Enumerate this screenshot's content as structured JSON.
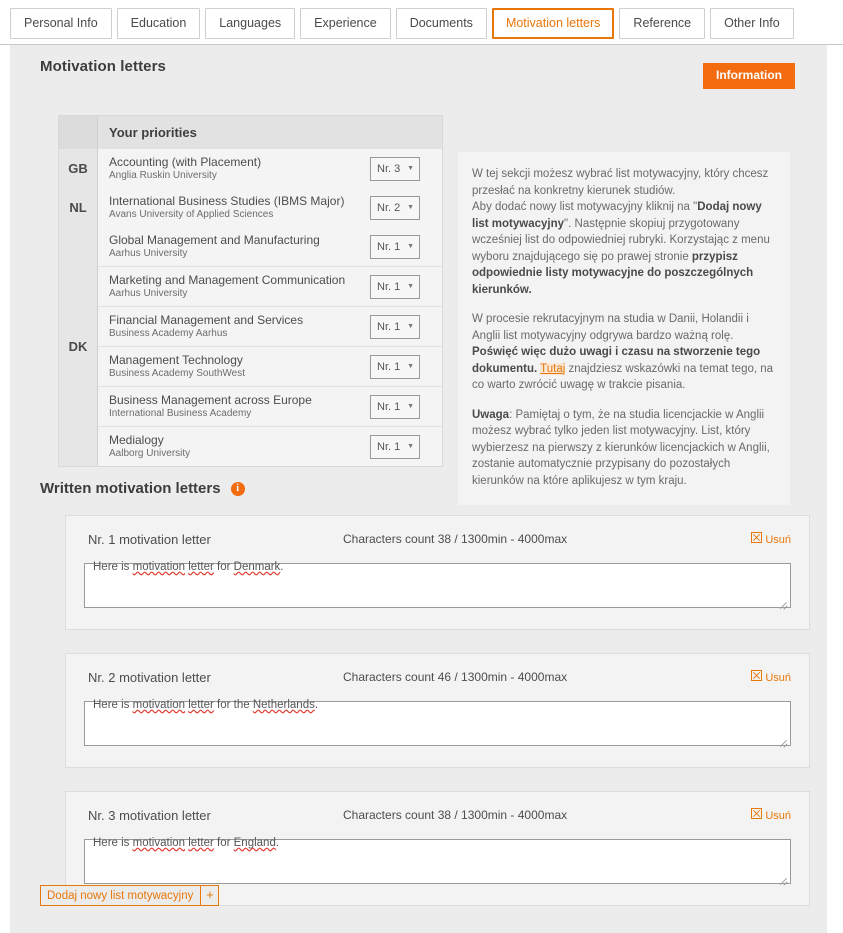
{
  "tabs": [
    {
      "label": "Personal Info",
      "active": false
    },
    {
      "label": "Education",
      "active": false
    },
    {
      "label": "Languages",
      "active": false
    },
    {
      "label": "Experience",
      "active": false
    },
    {
      "label": "Documents",
      "active": false
    },
    {
      "label": "Motivation letters",
      "active": true
    },
    {
      "label": "Reference",
      "active": false
    },
    {
      "label": "Other Info",
      "active": false
    }
  ],
  "page": {
    "title": "Motivation letters",
    "information_button": "Information"
  },
  "priorities_table": {
    "header": {
      "country": "",
      "title": "Your priorities",
      "select": ""
    },
    "groups": [
      {
        "country": "GB",
        "rows": [
          {
            "program": "Accounting (with Placement)",
            "institution": "Anglia Ruskin University",
            "selected": "Nr. 3"
          }
        ]
      },
      {
        "country": "NL",
        "rows": [
          {
            "program": "International Business Studies (IBMS Major)",
            "institution": "Avans University of Applied Sciences",
            "selected": "Nr. 2"
          }
        ]
      },
      {
        "country": "DK",
        "rows": [
          {
            "program": "Global Management and Manufacturing",
            "institution": "Aarhus University",
            "selected": "Nr. 1"
          },
          {
            "program": "Marketing and Management Communication",
            "institution": "Aarhus University",
            "selected": "Nr. 1"
          },
          {
            "program": "Financial Management and Services",
            "institution": "Business Academy Aarhus",
            "selected": "Nr. 1"
          },
          {
            "program": "Management Technology",
            "institution": "Business Academy SouthWest",
            "selected": "Nr. 1"
          },
          {
            "program": "Business Management across Europe",
            "institution": "International Business Academy",
            "selected": "Nr. 1"
          },
          {
            "program": "Medialogy",
            "institution": "Aalborg University",
            "selected": "Nr. 1"
          }
        ]
      }
    ]
  },
  "info_panel": {
    "p1_a": "W tej sekcji możesz wybrać list motywacyjny, który chcesz przesłać na konkretny kierunek studiów.",
    "p1_b": "Aby dodać nowy list motywacyjny kliknij na \"",
    "p1_bold1": "Dodaj nowy list motywacyjny",
    "p1_c": "\". Następnie skopiuj przygotowany wcześniej list do odpowiedniej rubryki. Korzystając z menu wyboru znajdującego się po prawej stronie ",
    "p1_bold2": "przypisz odpowiednie listy motywacyjne do poszczególnych kierunków.",
    "p2_a": "W procesie rekrutacyjnym na studia w Danii, Holandii i Anglii list motywacyjny odgrywa bardzo ważną rolę. ",
    "p2_bold": "Poświęć więc dużo uwagi i czasu na stworzenie tego dokumentu.",
    "p2_link": "Tutaj",
    "p2_b": " znajdziesz wskazówki na temat tego, na co warto zwrócić uwagę w trakcie pisania.",
    "p3_bold": "Uwaga",
    "p3_a": ": Pamiętaj o tym, że na studia licencjackie w Anglii możesz wybrać tylko jeden list motywacyjny. List, który wybierzesz na pierwszy z kierunków licencjackich w Anglii, zostanie automatycznie przypisany do pozostałych kierunków na które aplikujesz w tym kraju."
  },
  "written_section": {
    "title": "Written motivation letters",
    "info_icon": "i"
  },
  "letters": [
    {
      "title": "Nr. 1 motivation letter",
      "count_label": "Characters count 38 / 1300min - 4000max",
      "delete_label": "Usuń",
      "text_pre": "Here is ",
      "text_sp1": "motivation",
      "text_mid1": " ",
      "text_sp2": "letter",
      "text_mid2": " for ",
      "text_sp3": "Denmark",
      "text_post": ".",
      "value": "Here is motivation letter for Denmark."
    },
    {
      "title": "Nr. 2 motivation letter",
      "count_label": "Characters count 46 / 1300min - 4000max",
      "delete_label": "Usuń",
      "text_pre": "Here is ",
      "text_sp1": "motivation",
      "text_mid1": " ",
      "text_sp2": "letter",
      "text_mid2": " for the ",
      "text_sp3": "Netherlands",
      "text_post": ".",
      "value": "Here is motivation letter for the Netherlands."
    },
    {
      "title": "Nr. 3 motivation letter",
      "count_label": "Characters count 38 / 1300min - 4000max",
      "delete_label": "Usuń",
      "text_pre": "Here is ",
      "text_sp1": "motivation",
      "text_mid1": " ",
      "text_sp2": "letter",
      "text_mid2": " for ",
      "text_sp3": "England",
      "text_post": ".",
      "value": "Here is motivation letter for England."
    }
  ],
  "add_button": {
    "label": "Dodaj nowy list motywacyjny",
    "plus": "+"
  },
  "colors": {
    "accent": "#e8770a",
    "info_button": "#f26b0f",
    "panel_bg": "#ececec",
    "card_bg": "#f3f3f3"
  }
}
